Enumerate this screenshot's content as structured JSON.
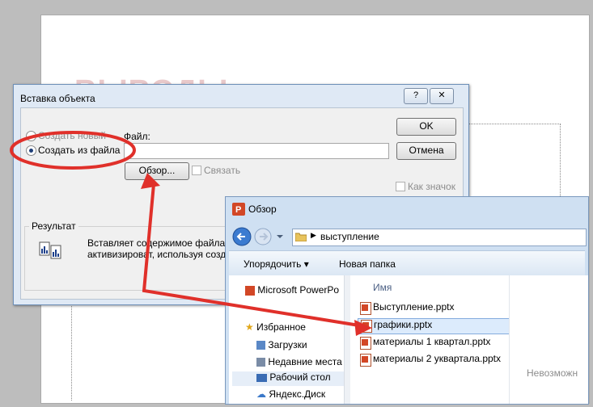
{
  "slide": {
    "title": "ВЫВОДЫ"
  },
  "insert_dialog": {
    "title": "Вставка объекта",
    "help_label": "?",
    "close_label": "✕",
    "create_new_label": "Создать новый",
    "create_from_file_label": "Создать из файла",
    "file_label": "Файл:",
    "file_value": "",
    "browse_button": "Обзор...",
    "link_label": "Связать",
    "ok_button": "OK",
    "cancel_button": "Отмена",
    "as_icon_label": "Как значок",
    "result_label": "Результат",
    "result_text_1": "Вставляет содержимое файла ка",
    "result_text_2": "активизироват, используя созд"
  },
  "browse_window": {
    "title": "Обзор",
    "breadcrumb_folder": "выступление",
    "organize_button": "Упорядочить ▾",
    "new_folder_button": "Новая папка",
    "nav_items": [
      {
        "label": "Microsoft PowerPo",
        "icon": "powerpoint-icon"
      },
      {
        "label": "Избранное",
        "icon": "star-icon"
      },
      {
        "label": "Загрузки",
        "icon": "downloads-icon"
      },
      {
        "label": "Недавние места",
        "icon": "recent-places-icon"
      },
      {
        "label": "Рабочий стол",
        "icon": "desktop-icon"
      },
      {
        "label": "Яндекс.Диск",
        "icon": "cloud-icon"
      }
    ],
    "column_name": "Имя",
    "files": [
      {
        "name": "Выступление.pptx"
      },
      {
        "name": "графики.pptx",
        "selected": true
      },
      {
        "name": "материалы 1 квартал.pptx"
      },
      {
        "name": "материалы 2 уквартала.pptx"
      }
    ],
    "preview_text": "Невозможн"
  },
  "colors": {
    "annotation_red": "#e0302a",
    "window_frame": "#cfe0f2",
    "selection": "#dcebfc"
  }
}
